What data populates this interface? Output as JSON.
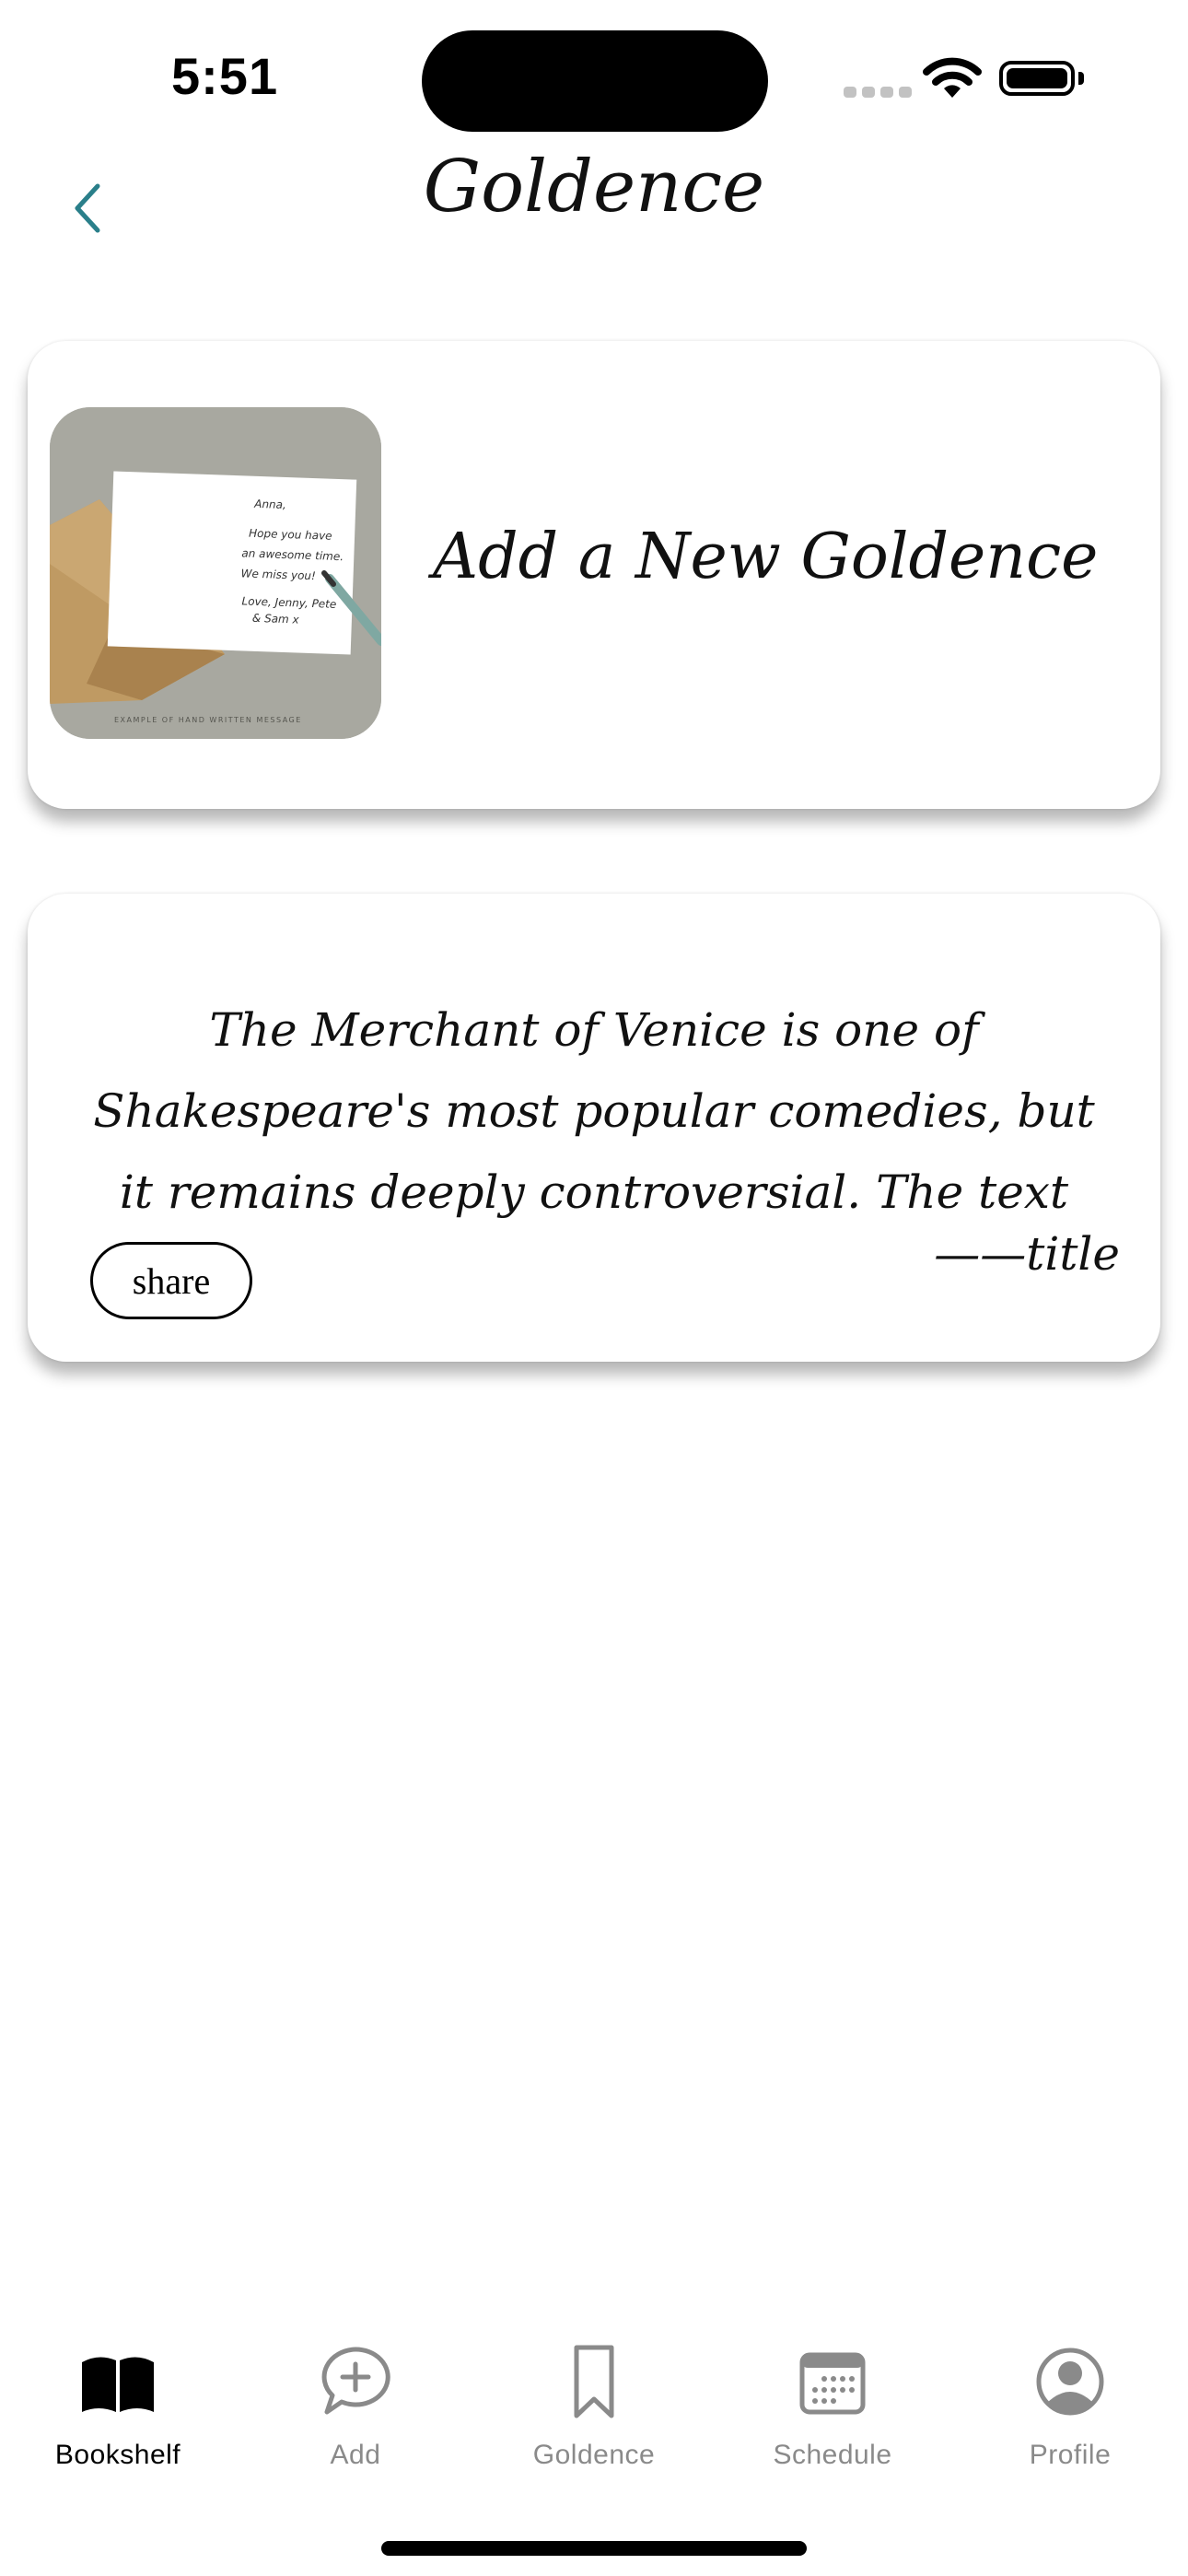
{
  "status_bar": {
    "time": "5:51"
  },
  "nav": {
    "title": "Goldence",
    "back_icon": "chevron-left-icon",
    "accent": "#2a7f8a"
  },
  "add_card": {
    "label": "Add a New Goldence",
    "image_note_lines": [
      "Anna,",
      "Hope you have",
      "an awesome time.",
      "We miss you!",
      "Love, Jenny, Pete",
      "& Sam x"
    ],
    "image_caption": "EXAMPLE OF HAND WRITTEN MESSAGE"
  },
  "quote_card": {
    "text": "The Merchant of Venice is one of Shakespeare's most popular comedies, but it remains deeply controversial. The text may seem anti-Semitic; yet repeatedly, in",
    "attribution": "——title",
    "share_label": "share"
  },
  "tabs": [
    {
      "label": "Bookshelf",
      "icon": "open-book-icon",
      "active": true
    },
    {
      "label": "Add",
      "icon": "add-comment-icon",
      "active": false
    },
    {
      "label": "Goldence",
      "icon": "bookmark-icon",
      "active": false
    },
    {
      "label": "Schedule",
      "icon": "calendar-icon",
      "active": false
    },
    {
      "label": "Profile",
      "icon": "profile-icon",
      "active": false
    }
  ],
  "colors": {
    "active_tab": "#000000",
    "inactive_tab": "#8a8a8a",
    "background": "#ffffff"
  }
}
